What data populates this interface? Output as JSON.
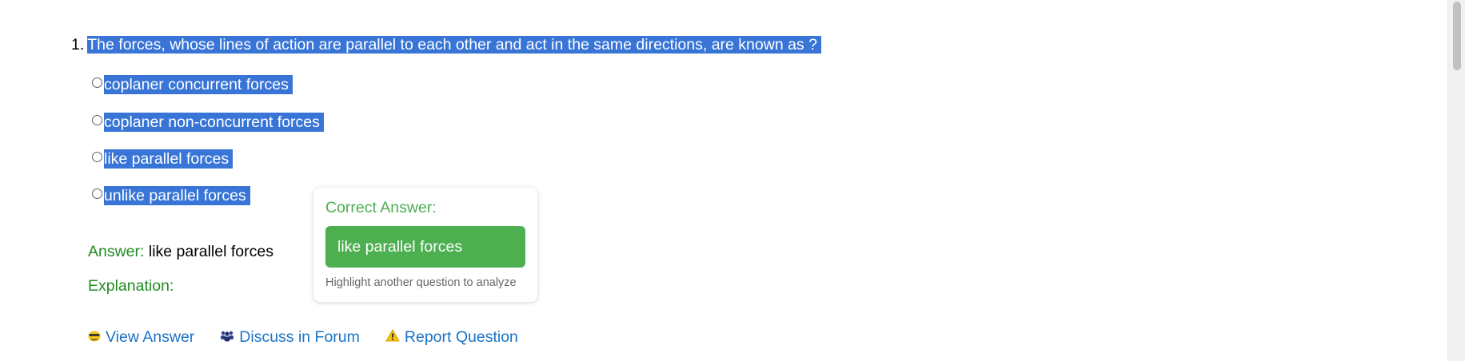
{
  "question": {
    "number": "1.",
    "text": "The forces, whose lines of action are parallel to each other and act in the same directions, are known as ?",
    "options": [
      "coplaner concurrent forces",
      "coplaner non-concurrent forces",
      "like parallel forces",
      "unlike parallel forces"
    ]
  },
  "answer": {
    "label": "Answer:",
    "value": "like parallel forces"
  },
  "explanation": {
    "label": "Explanation:"
  },
  "links": {
    "view_answer": "View Answer",
    "discuss": "Discuss in Forum",
    "report": "Report Question"
  },
  "popup": {
    "title": "Correct Answer:",
    "answer": "like parallel forces",
    "hint": "Highlight another question to analyze"
  },
  "colors": {
    "selection": "#3875d7",
    "green": "#228b22",
    "popup_green": "#4caf50",
    "link_blue": "#1a73c7"
  },
  "icons": {
    "view_answer": "eye-icon",
    "discuss": "users-icon",
    "report": "warning-icon"
  }
}
